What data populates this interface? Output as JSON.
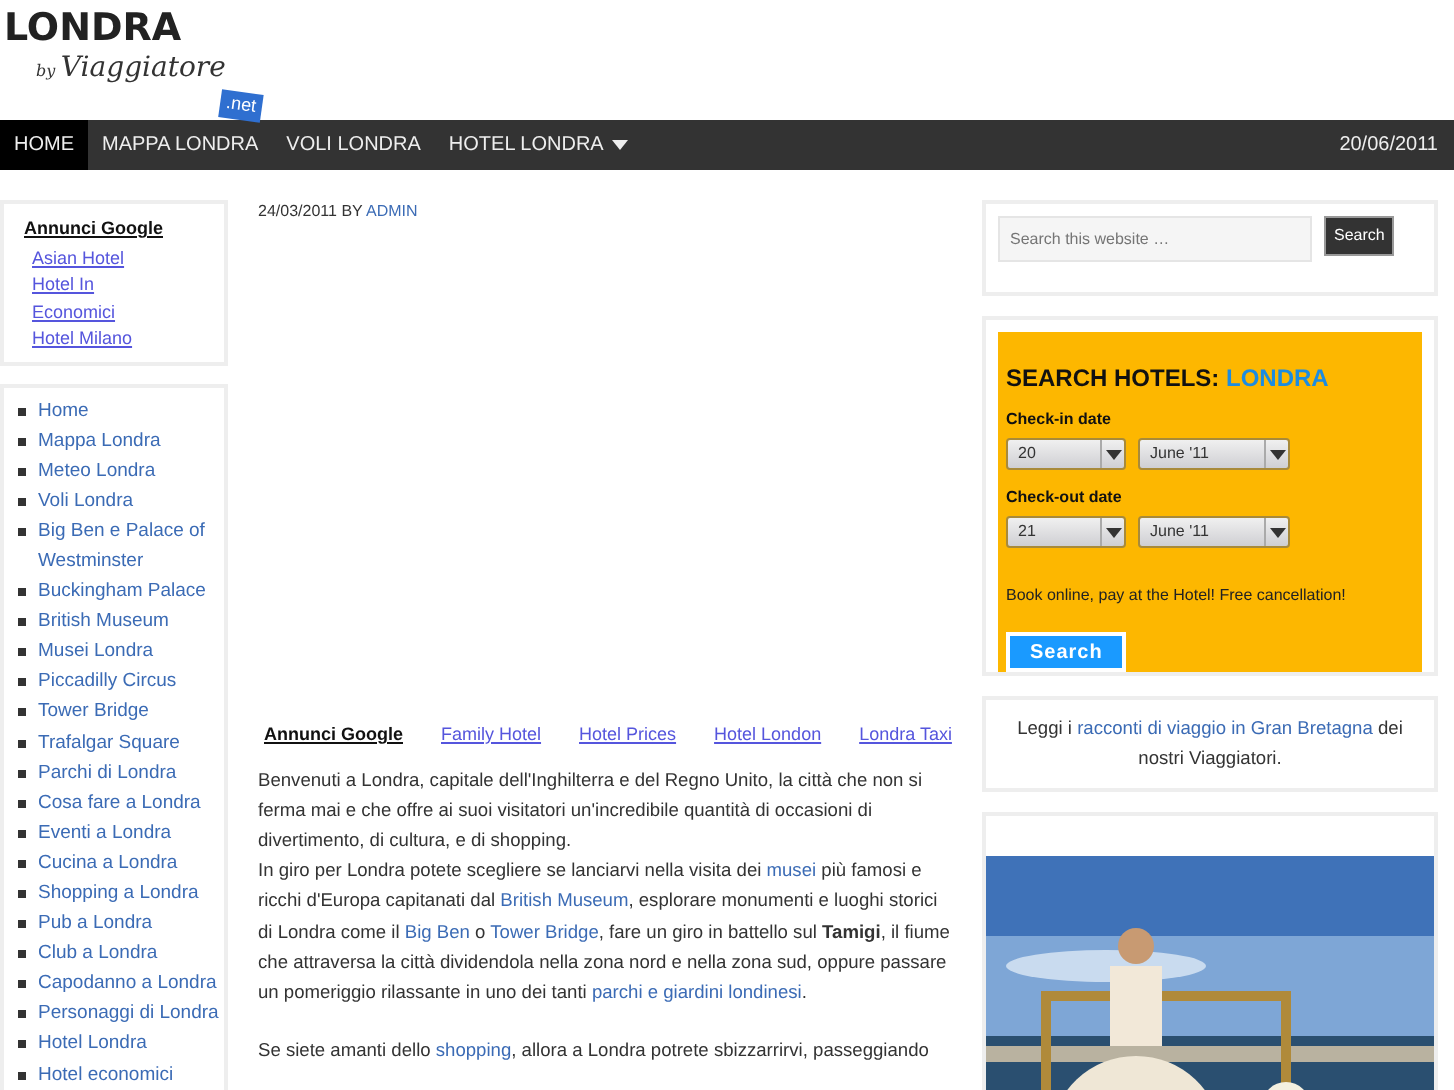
{
  "logo": {
    "title": "LONDRA",
    "by": "by",
    "brand": "Viaggiatore",
    "tag": ".net"
  },
  "nav": {
    "items": [
      {
        "label": "HOME",
        "selected": true,
        "dropdown": false
      },
      {
        "label": "MAPPA LONDRA",
        "selected": false,
        "dropdown": false
      },
      {
        "label": "VOLI LONDRA",
        "selected": false,
        "dropdown": false
      },
      {
        "label": "HOTEL LONDRA",
        "selected": false,
        "dropdown": true
      }
    ],
    "date": "20/06/2011"
  },
  "left_ads": {
    "title": "Annunci Google",
    "links": [
      "Asian Hotel",
      "Hotel In",
      "Economici",
      "Hotel Milano"
    ]
  },
  "sidebar": {
    "items": [
      "Home",
      "Mappa Londra",
      "Meteo Londra",
      "Voli Londra",
      "Big Ben e Palace of Westminster",
      "Buckingham Palace",
      "British Museum",
      "Musei Londra",
      "Piccadilly Circus",
      "Tower Bridge",
      "Trafalgar Square",
      "Parchi di Londra",
      "Cosa fare a Londra",
      "Eventi a Londra",
      "Cucina a Londra",
      "Shopping a Londra",
      "Pub a Londra",
      "Club a Londra",
      "Capodanno a Londra",
      "Personaggi di Londra",
      "Hotel Londra",
      "Hotel economici"
    ]
  },
  "post": {
    "date": "24/03/2011",
    "by": "BY",
    "author": "ADMIN",
    "ads": {
      "title": "Annunci Google",
      "links": [
        "Family Hotel",
        "Hotel Prices",
        "Hotel London",
        "Londra Taxi"
      ]
    },
    "paragraphs": [
      [
        {
          "kind": "plain",
          "text": "Benvenuti a Londra, capitale dell'Inghilterra e del Regno Unito, la città che non si ferma mai e che offre ai suoi visitatori un'incredibile quantità di occasioni di divertimento, di cultura, e di shopping."
        }
      ],
      [
        {
          "kind": "plain",
          "text": "In giro per Londra potete scegliere se lanciarvi nella visita dei "
        },
        {
          "kind": "link",
          "text": "musei"
        },
        {
          "kind": "plain",
          "text": " più famosi e ricchi d'Europa capitanati dal "
        },
        {
          "kind": "link",
          "text": "British Museum"
        },
        {
          "kind": "plain",
          "text": ", esplorare monumenti e luoghi storici di Londra come il "
        },
        {
          "kind": "link",
          "text": "Big Ben"
        },
        {
          "kind": "plain",
          "text": " o "
        },
        {
          "kind": "link",
          "text": "Tower Bridge"
        },
        {
          "kind": "plain",
          "text": ", fare un giro in battello sul "
        },
        {
          "kind": "bold",
          "text": "Tamigi"
        },
        {
          "kind": "plain",
          "text": ", il fiume che attraversa la città dividendola nella zona nord e nella zona sud, oppure passare un pomeriggio rilassante in uno dei tanti "
        },
        {
          "kind": "link",
          "text": "parchi e giardini londinesi"
        },
        {
          "kind": "plain",
          "text": "."
        }
      ],
      [
        {
          "kind": "plain",
          "text": "Se siete amanti dello "
        },
        {
          "kind": "link",
          "text": "shopping"
        },
        {
          "kind": "plain",
          "text": ", allora a Londra potrete sbizzarrirvi, passeggiando"
        }
      ]
    ]
  },
  "search": {
    "placeholder": "Search this website …",
    "button": "Search"
  },
  "hotels": {
    "title": "SEARCH HOTELS:",
    "city": "LONDRA",
    "checkin": {
      "label": "Check-in date",
      "day": "20",
      "month": "June '11"
    },
    "checkout": {
      "label": "Check-out date",
      "day": "21",
      "month": "June '11"
    },
    "note": "Book online, pay at the Hotel! Free cancellation!",
    "button": "Search"
  },
  "stories": [
    {
      "kind": "plain",
      "text": "Leggi i "
    },
    {
      "kind": "link",
      "text": "racconti di viaggio in Gran Bretagna"
    },
    {
      "kind": "plain",
      "text": " dei nostri Viaggiatori."
    }
  ]
}
